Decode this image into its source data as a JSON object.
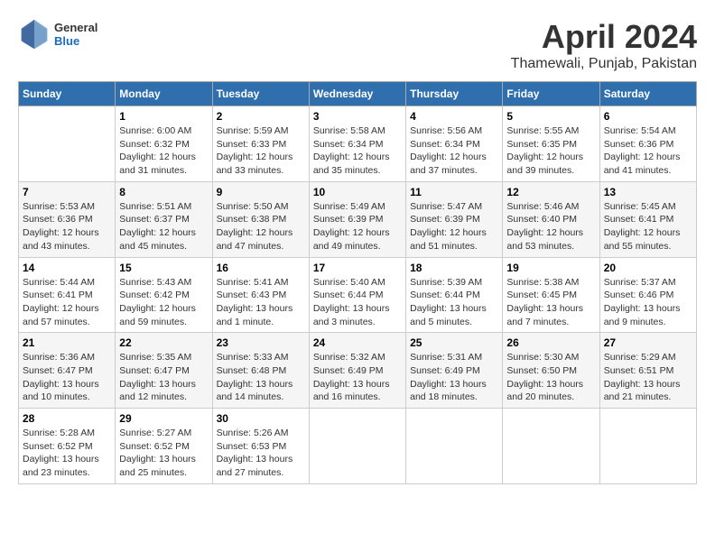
{
  "header": {
    "logo": {
      "general": "General",
      "blue": "Blue"
    },
    "title": "April 2024",
    "subtitle": "Thamewali, Punjab, Pakistan"
  },
  "calendar": {
    "weekdays": [
      "Sunday",
      "Monday",
      "Tuesday",
      "Wednesday",
      "Thursday",
      "Friday",
      "Saturday"
    ],
    "weeks": [
      [
        {
          "day": "",
          "info": ""
        },
        {
          "day": "1",
          "info": "Sunrise: 6:00 AM\nSunset: 6:32 PM\nDaylight: 12 hours\nand 31 minutes."
        },
        {
          "day": "2",
          "info": "Sunrise: 5:59 AM\nSunset: 6:33 PM\nDaylight: 12 hours\nand 33 minutes."
        },
        {
          "day": "3",
          "info": "Sunrise: 5:58 AM\nSunset: 6:34 PM\nDaylight: 12 hours\nand 35 minutes."
        },
        {
          "day": "4",
          "info": "Sunrise: 5:56 AM\nSunset: 6:34 PM\nDaylight: 12 hours\nand 37 minutes."
        },
        {
          "day": "5",
          "info": "Sunrise: 5:55 AM\nSunset: 6:35 PM\nDaylight: 12 hours\nand 39 minutes."
        },
        {
          "day": "6",
          "info": "Sunrise: 5:54 AM\nSunset: 6:36 PM\nDaylight: 12 hours\nand 41 minutes."
        }
      ],
      [
        {
          "day": "7",
          "info": "Sunrise: 5:53 AM\nSunset: 6:36 PM\nDaylight: 12 hours\nand 43 minutes."
        },
        {
          "day": "8",
          "info": "Sunrise: 5:51 AM\nSunset: 6:37 PM\nDaylight: 12 hours\nand 45 minutes."
        },
        {
          "day": "9",
          "info": "Sunrise: 5:50 AM\nSunset: 6:38 PM\nDaylight: 12 hours\nand 47 minutes."
        },
        {
          "day": "10",
          "info": "Sunrise: 5:49 AM\nSunset: 6:39 PM\nDaylight: 12 hours\nand 49 minutes."
        },
        {
          "day": "11",
          "info": "Sunrise: 5:47 AM\nSunset: 6:39 PM\nDaylight: 12 hours\nand 51 minutes."
        },
        {
          "day": "12",
          "info": "Sunrise: 5:46 AM\nSunset: 6:40 PM\nDaylight: 12 hours\nand 53 minutes."
        },
        {
          "day": "13",
          "info": "Sunrise: 5:45 AM\nSunset: 6:41 PM\nDaylight: 12 hours\nand 55 minutes."
        }
      ],
      [
        {
          "day": "14",
          "info": "Sunrise: 5:44 AM\nSunset: 6:41 PM\nDaylight: 12 hours\nand 57 minutes."
        },
        {
          "day": "15",
          "info": "Sunrise: 5:43 AM\nSunset: 6:42 PM\nDaylight: 12 hours\nand 59 minutes."
        },
        {
          "day": "16",
          "info": "Sunrise: 5:41 AM\nSunset: 6:43 PM\nDaylight: 13 hours\nand 1 minute."
        },
        {
          "day": "17",
          "info": "Sunrise: 5:40 AM\nSunset: 6:44 PM\nDaylight: 13 hours\nand 3 minutes."
        },
        {
          "day": "18",
          "info": "Sunrise: 5:39 AM\nSunset: 6:44 PM\nDaylight: 13 hours\nand 5 minutes."
        },
        {
          "day": "19",
          "info": "Sunrise: 5:38 AM\nSunset: 6:45 PM\nDaylight: 13 hours\nand 7 minutes."
        },
        {
          "day": "20",
          "info": "Sunrise: 5:37 AM\nSunset: 6:46 PM\nDaylight: 13 hours\nand 9 minutes."
        }
      ],
      [
        {
          "day": "21",
          "info": "Sunrise: 5:36 AM\nSunset: 6:47 PM\nDaylight: 13 hours\nand 10 minutes."
        },
        {
          "day": "22",
          "info": "Sunrise: 5:35 AM\nSunset: 6:47 PM\nDaylight: 13 hours\nand 12 minutes."
        },
        {
          "day": "23",
          "info": "Sunrise: 5:33 AM\nSunset: 6:48 PM\nDaylight: 13 hours\nand 14 minutes."
        },
        {
          "day": "24",
          "info": "Sunrise: 5:32 AM\nSunset: 6:49 PM\nDaylight: 13 hours\nand 16 minutes."
        },
        {
          "day": "25",
          "info": "Sunrise: 5:31 AM\nSunset: 6:49 PM\nDaylight: 13 hours\nand 18 minutes."
        },
        {
          "day": "26",
          "info": "Sunrise: 5:30 AM\nSunset: 6:50 PM\nDaylight: 13 hours\nand 20 minutes."
        },
        {
          "day": "27",
          "info": "Sunrise: 5:29 AM\nSunset: 6:51 PM\nDaylight: 13 hours\nand 21 minutes."
        }
      ],
      [
        {
          "day": "28",
          "info": "Sunrise: 5:28 AM\nSunset: 6:52 PM\nDaylight: 13 hours\nand 23 minutes."
        },
        {
          "day": "29",
          "info": "Sunrise: 5:27 AM\nSunset: 6:52 PM\nDaylight: 13 hours\nand 25 minutes."
        },
        {
          "day": "30",
          "info": "Sunrise: 5:26 AM\nSunset: 6:53 PM\nDaylight: 13 hours\nand 27 minutes."
        },
        {
          "day": "",
          "info": ""
        },
        {
          "day": "",
          "info": ""
        },
        {
          "day": "",
          "info": ""
        },
        {
          "day": "",
          "info": ""
        }
      ]
    ]
  }
}
